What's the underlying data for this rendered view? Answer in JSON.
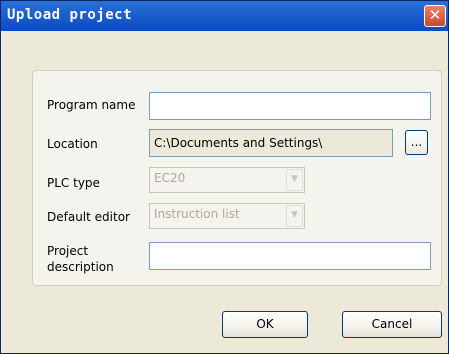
{
  "window": {
    "title": "Upload project",
    "close_glyph": "✕"
  },
  "form": {
    "program_name": {
      "label": "Program name",
      "value": ""
    },
    "location": {
      "label": "Location",
      "value": "C:\\Documents and Settings\\",
      "browse_label": "..."
    },
    "plc_type": {
      "label": "PLC type",
      "selected": "EC20"
    },
    "default_editor": {
      "label": "Default editor",
      "selected": "Instruction list"
    },
    "project_description": {
      "label_line1": "Project",
      "label_line2": "description",
      "value": ""
    }
  },
  "buttons": {
    "ok": "OK",
    "cancel": "Cancel"
  },
  "icons": {
    "close": "close-icon",
    "dropdown": "chevron-down-icon"
  },
  "colors": {
    "titlebar": "#1c5fcc",
    "dialog_bg": "#ece9d8",
    "close_button": "#c74a2a"
  }
}
